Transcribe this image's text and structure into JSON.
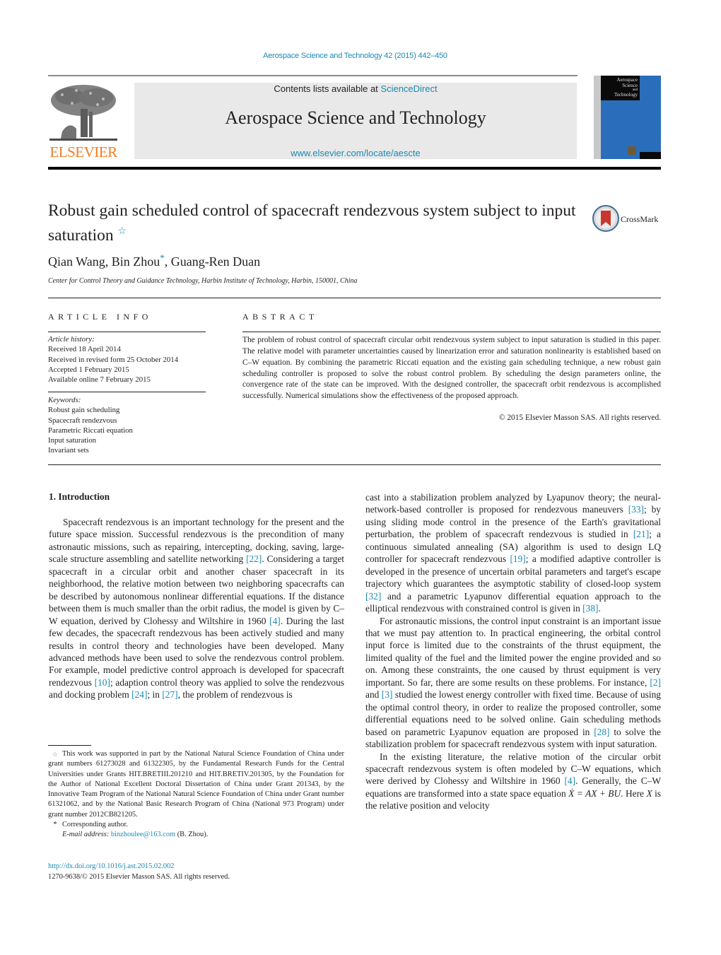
{
  "header": {
    "journal_reference": "Aerospace Science and Technology 42 (2015) 442–450",
    "contents_prefix": "Contents lists available at ",
    "contents_link": "ScienceDirect",
    "journal_title": "Aerospace Science and Technology",
    "journal_url": "www.elsevier.com/locate/aescte",
    "publisher_logo_text": "ELSEVIER",
    "cover_title_lines": [
      "Aerospace",
      "Science",
      "and",
      "Technology"
    ],
    "colors": {
      "link": "#1a8ab4",
      "elsevier_orange": "#f47b20",
      "cover_blue": "#2a6ebb"
    }
  },
  "article": {
    "title": "Robust gain scheduled control of spacecraft rendezvous system subject to input saturation",
    "title_note_mark": "☆",
    "crossmark_label": "CrossMark",
    "authors": [
      {
        "name": "Qian Wang",
        "mark": ""
      },
      {
        "name": "Bin Zhou",
        "mark": "*"
      },
      {
        "name": "Guang-Ren Duan",
        "mark": ""
      }
    ],
    "authors_line_part1": "Qian Wang, Bin Zhou",
    "authors_line_mark": "*",
    "authors_line_part2": ", Guang-Ren Duan",
    "affiliation": "Center for Control Theory and Guidance Technology, Harbin Institute of Technology, Harbin, 150001, China"
  },
  "article_info": {
    "heading": "ARTICLE INFO",
    "history_label": "Article history:",
    "history": [
      "Received 18 April 2014",
      "Received in revised form 25 October 2014",
      "Accepted 1 February 2015",
      "Available online 7 February 2015"
    ],
    "keywords_label": "Keywords:",
    "keywords": [
      "Robust gain scheduling",
      "Spacecraft rendezvous",
      "Parametric Riccati equation",
      "Input saturation",
      "Invariant sets"
    ]
  },
  "abstract": {
    "heading": "ABSTRACT",
    "text": "The problem of robust control of spacecraft circular orbit rendezvous system subject to input saturation is studied in this paper. The relative model with parameter uncertainties caused by linearization error and saturation nonlinearity is established based on C–W equation. By combining the parametric Riccati equation and the existing gain scheduling technique, a new robust gain scheduling controller is proposed to solve the robust control problem. By scheduling the design parameters online, the convergence rate of the state can be improved. With the designed controller, the spacecraft orbit rendezvous is accomplished successfully. Numerical simulations show the effectiveness of the proposed approach.",
    "copyright": "© 2015 Elsevier Masson SAS. All rights reserved."
  },
  "body": {
    "section_heading": "1.  Introduction",
    "left_para1": [
      {
        "t": "Spacecraft rendezvous is an important technology for the present and the future space mission. Successful rendezvous is the precondition of many astronautic missions, such as repairing, intercepting, docking, saving, large-scale structure assembling and satellite networking "
      },
      {
        "ref": "[22]"
      },
      {
        "t": ". Considering a target spacecraft in a circular orbit and another chaser spacecraft in its neighborhood, the relative motion between two neighboring spacecrafts can be described by autonomous nonlinear differential equations. If the distance between them is much smaller than the orbit radius, the model is given by C–W equation, derived by Clohessy and Wiltshire in 1960 "
      },
      {
        "ref": "[4]"
      },
      {
        "t": ". During the last few decades, the spacecraft rendezvous has been actively studied and many results in control theory and technologies have been developed. Many advanced methods have been used to solve the rendezvous control problem. For example, model predictive control approach is developed for spacecraft rendezvous "
      },
      {
        "ref": "[10]"
      },
      {
        "t": "; adaption control theory was applied to solve the rendezvous and docking problem "
      },
      {
        "ref": "[24]"
      },
      {
        "t": "; in "
      },
      {
        "ref": "[27]"
      },
      {
        "t": ", the problem of rendezvous is"
      }
    ],
    "right_para1": [
      {
        "t": "cast into a stabilization problem analyzed by Lyapunov theory; the neural-network-based controller is proposed for rendezvous maneuvers "
      },
      {
        "ref": "[33]"
      },
      {
        "t": "; by using sliding mode control in the presence of the Earth's gravitational perturbation, the problem of spacecraft rendezvous is studied in "
      },
      {
        "ref": "[21]"
      },
      {
        "t": "; a continuous simulated annealing (SA) algorithm is used to design LQ controller for spacecraft rendezvous "
      },
      {
        "ref": "[19]"
      },
      {
        "t": "; a modified adaptive controller is developed in the presence of uncertain orbital parameters and target's escape trajectory which guarantees the asymptotic stability of closed-loop system "
      },
      {
        "ref": "[32]"
      },
      {
        "t": " and a parametric Lyapunov differential equation approach to the elliptical rendezvous with constrained control is given in "
      },
      {
        "ref": "[38]"
      },
      {
        "t": "."
      }
    ],
    "right_para2": [
      {
        "t": "For astronautic missions, the control input constraint is an important issue that we must pay attention to. In practical engineering, the orbital control input force is limited due to the constraints of the thrust equipment, the limited quality of the fuel and the limited power the engine provided and so on. Among these constraints, the one caused by thrust equipment is very important. So far, there are some results on these problems. For instance, "
      },
      {
        "ref": "[2]"
      },
      {
        "t": " and "
      },
      {
        "ref": "[3]"
      },
      {
        "t": " studied the lowest energy controller with fixed time. Because of using the optimal control theory, in order to realize the proposed controller, some differential equations need to be solved online. Gain scheduling methods based on parametric Lyapunov equation are proposed in "
      },
      {
        "ref": "[28]"
      },
      {
        "t": " to solve the stabilization problem for spacecraft rendezvous system with input saturation."
      }
    ],
    "right_para3": [
      {
        "t": "In the existing literature, the relative motion of the circular orbit spacecraft rendezvous system is often modeled by C–W equations, which were derived by Clohessy and Wiltshire in 1960 "
      },
      {
        "ref": "[4]"
      },
      {
        "t": ". Generally, the C–W equations are transformed into a state space equation "
      },
      {
        "math": "Ẋ = AX + BU"
      },
      {
        "t": ". Here "
      },
      {
        "math": "X"
      },
      {
        "t": " is the relative position and velocity"
      }
    ]
  },
  "footnotes": {
    "star_mark": "☆",
    "funding": "This work was supported in part by the National Natural Science Foundation of China under grant numbers 61273028 and 61322305, by the Fundamental Research Funds for the Central Universities under Grants HIT.BRETIII.201210 and HIT.BRETIV.201305, by the Foundation for the Author of National Excellent Doctoral Dissertation of China under Grant 201343, by the Innovative Team Program of the National Natural Science Foundation of China under Grant number 61321062, and by the National Basic Research Program of China (National 973 Program) under grant number 2012CB821205.",
    "corresponding_mark": "*",
    "corresponding": "Corresponding author.",
    "email_label": "E-mail address: ",
    "email": "binzhoulee@163.com",
    "email_suffix": " (B. Zhou).",
    "doi": "http://dx.doi.org/10.1016/j.ast.2015.02.002",
    "issn_copyright": "1270-9638/© 2015 Elsevier Masson SAS. All rights reserved."
  }
}
